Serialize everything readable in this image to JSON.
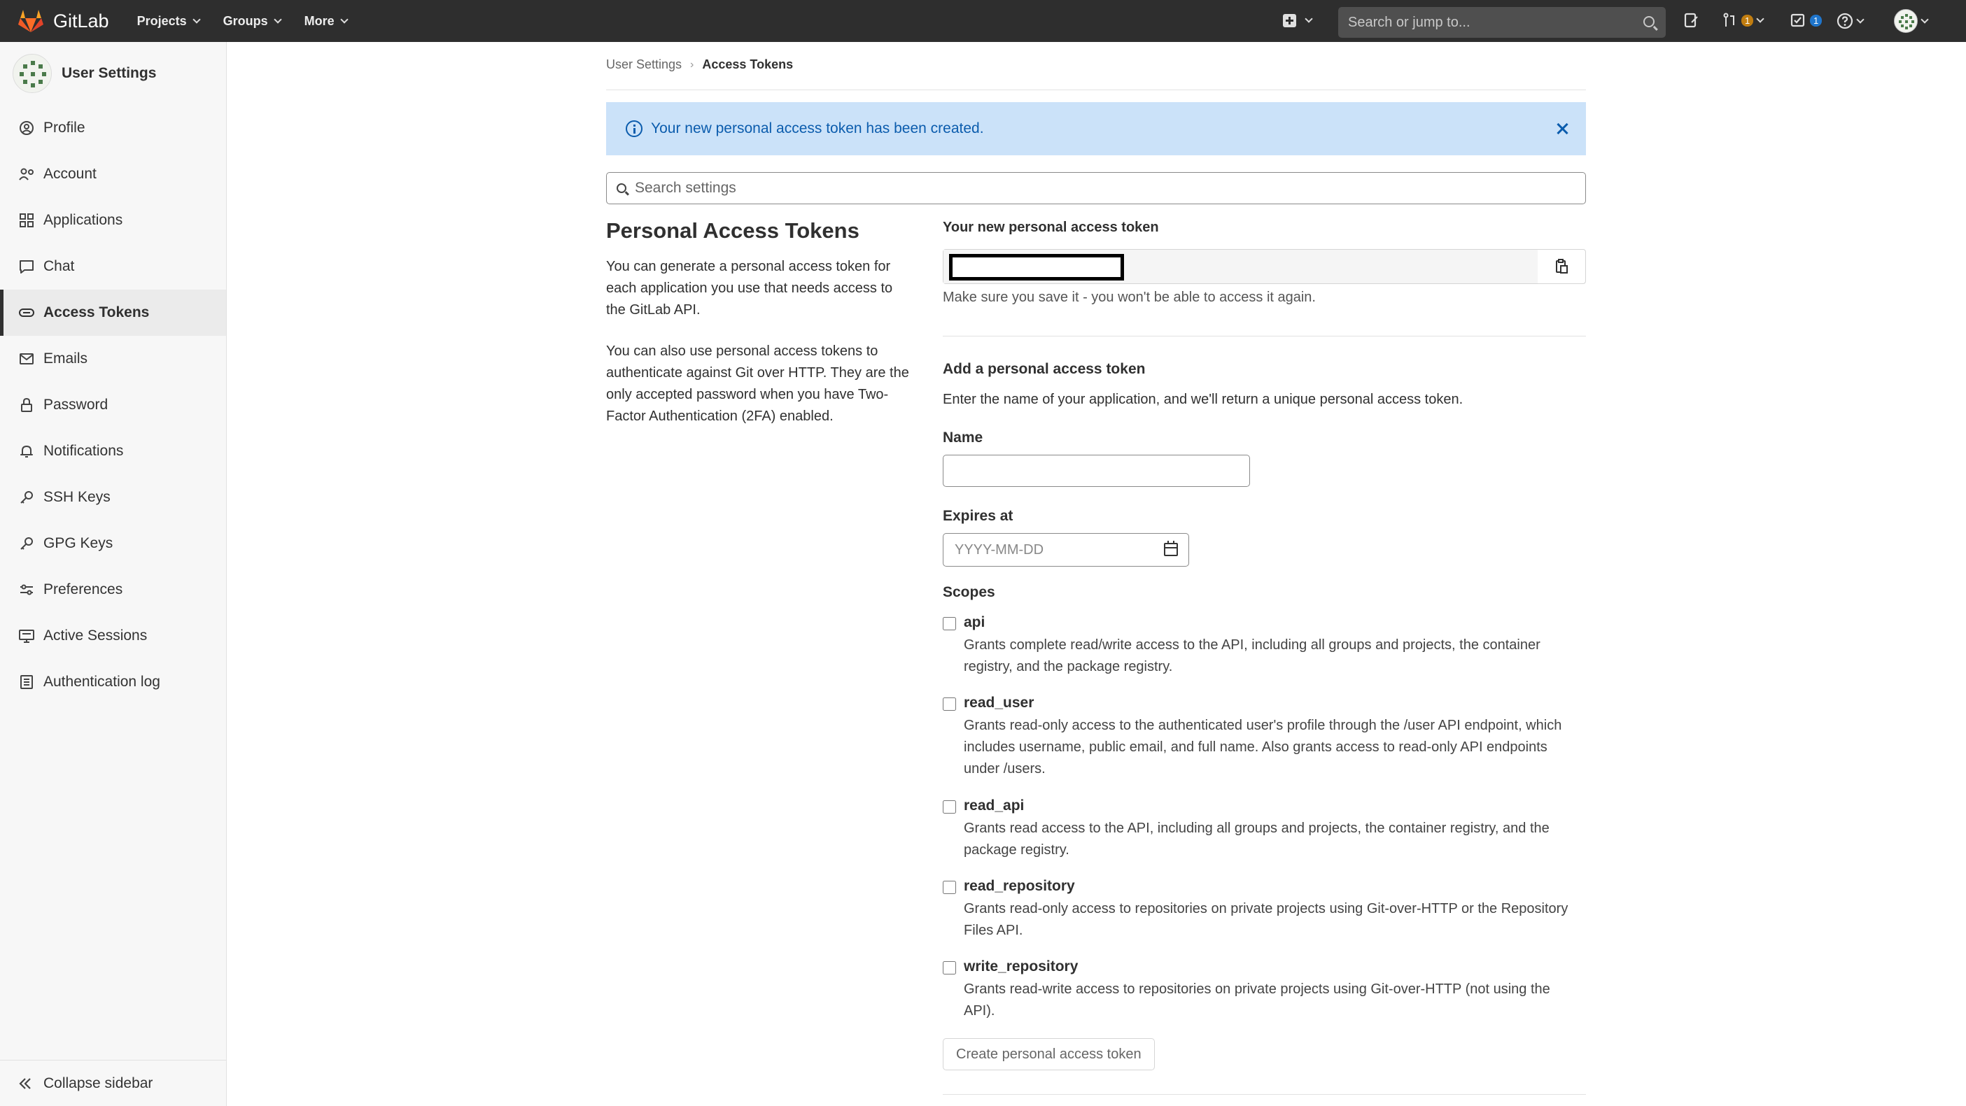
{
  "app": {
    "name": "GitLab",
    "nav": [
      "Projects",
      "Groups",
      "More"
    ],
    "search_placeholder": "Search or jump to...",
    "mr_count": "1",
    "todo_count": "1"
  },
  "sidebar": {
    "title": "User Settings",
    "items": [
      {
        "label": "Profile",
        "icon": "profile-icon"
      },
      {
        "label": "Account",
        "icon": "account-icon"
      },
      {
        "label": "Applications",
        "icon": "applications-icon"
      },
      {
        "label": "Chat",
        "icon": "chat-icon"
      },
      {
        "label": "Access Tokens",
        "icon": "token-icon"
      },
      {
        "label": "Emails",
        "icon": "mail-icon"
      },
      {
        "label": "Password",
        "icon": "lock-icon"
      },
      {
        "label": "Notifications",
        "icon": "bell-icon"
      },
      {
        "label": "SSH Keys",
        "icon": "key-icon"
      },
      {
        "label": "GPG Keys",
        "icon": "key-icon"
      },
      {
        "label": "Preferences",
        "icon": "preferences-icon"
      },
      {
        "label": "Active Sessions",
        "icon": "monitor-icon"
      },
      {
        "label": "Authentication log",
        "icon": "log-icon"
      }
    ],
    "active": "Access Tokens",
    "collapse_label": "Collapse sidebar"
  },
  "breadcrumb": {
    "parent": "User Settings",
    "separator": "›",
    "current": "Access Tokens"
  },
  "alert": {
    "message": "Your new personal access token has been created."
  },
  "settings_search": {
    "placeholder": "Search settings"
  },
  "intro": {
    "title": "Personal Access Tokens",
    "paragraph1": "You can generate a personal access token for each application you use that needs access to the GitLab API.",
    "paragraph2": "You can also use personal access tokens to authenticate against Git over HTTP. They are the only accepted password when you have Two-Factor Authentication (2FA) enabled."
  },
  "new_token": {
    "label": "Your new personal access token",
    "hint": "Make sure you save it - you won't be able to access it again."
  },
  "form": {
    "title": "Add a personal access token",
    "description": "Enter the name of your application, and we'll return a unique personal access token.",
    "name_label": "Name",
    "name_value": "",
    "expires_label": "Expires at",
    "expires_placeholder": "YYYY-MM-DD",
    "scopes_label": "Scopes",
    "scopes": [
      {
        "name": "api",
        "desc": "Grants complete read/write access to the API, including all groups and projects, the container registry, and the package registry.",
        "checked": false
      },
      {
        "name": "read_user",
        "desc": "Grants read-only access to the authenticated user's profile through the /user API endpoint, which includes username, public email, and full name. Also grants access to read-only API endpoints under /users.",
        "checked": false
      },
      {
        "name": "read_api",
        "desc": "Grants read access to the API, including all groups and projects, the container registry, and the package registry.",
        "checked": false
      },
      {
        "name": "read_repository",
        "desc": "Grants read-only access to repositories on private projects using Git-over-HTTP or the Repository Files API.",
        "checked": false
      },
      {
        "name": "write_repository",
        "desc": "Grants read-write access to repositories on private projects using Git-over-HTTP (not using the API).",
        "checked": false
      }
    ],
    "submit_label": "Create personal access token"
  },
  "colors": {
    "navbar": "#2e2e2e",
    "alert_bg": "#cbe2f9",
    "alert_text": "#0b5cad",
    "sidebar_bg": "#f7f7f7"
  }
}
